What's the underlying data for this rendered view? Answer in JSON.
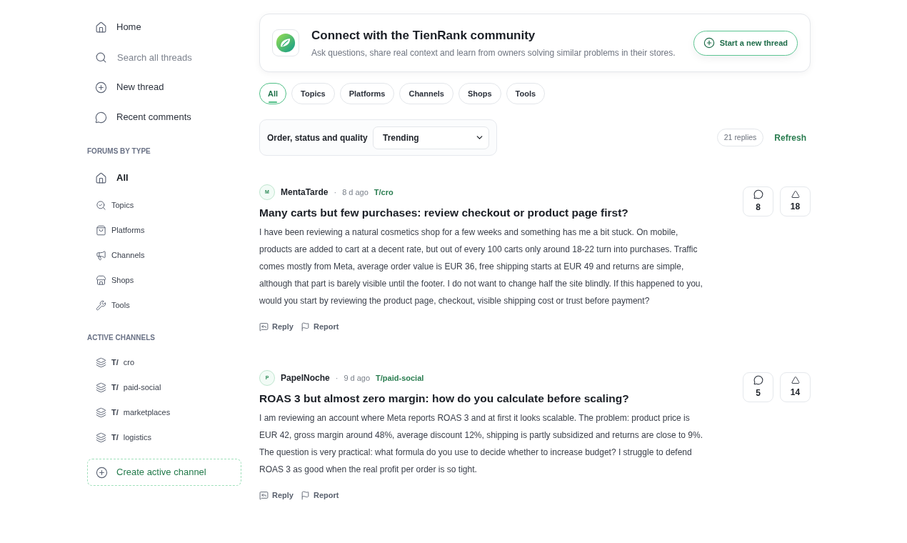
{
  "sidebar": {
    "nav": [
      {
        "kind": "link",
        "label": "Home"
      },
      {
        "kind": "search",
        "placeholder": "Search all threads"
      },
      {
        "kind": "link",
        "label": "New thread"
      },
      {
        "kind": "link",
        "label": "Recent comments"
      }
    ],
    "forums": {
      "heading": "FORUMS BY TYPE",
      "items": [
        {
          "label": "All",
          "selected": true
        },
        {
          "label": "Topics",
          "selected": false
        },
        {
          "label": "Platforms",
          "selected": false
        },
        {
          "label": "Channels",
          "selected": false
        },
        {
          "label": "Shops",
          "selected": false
        },
        {
          "label": "Tools",
          "selected": false
        }
      ]
    },
    "active_channels": {
      "heading": "ACTIVE CHANNELS",
      "items": [
        {
          "prefix": "T/",
          "name": "cro"
        },
        {
          "prefix": "T/",
          "name": "paid-social"
        },
        {
          "prefix": "T/",
          "name": "marketplaces"
        },
        {
          "prefix": "T/",
          "name": "logistics"
        }
      ],
      "create_button": "Create active channel"
    }
  },
  "header": {
    "title": "Connect with the TienRank community",
    "subtitle": "Ask questions, share real context and learn from owners solving similar problems in their stores.",
    "button": "Start a new thread"
  },
  "tabs": [
    {
      "label": "All",
      "selected": true
    },
    {
      "label": "Topics",
      "selected": false
    },
    {
      "label": "Platforms",
      "selected": false
    },
    {
      "label": "Channels",
      "selected": false
    },
    {
      "label": "Shops",
      "selected": false
    },
    {
      "label": "Tools",
      "selected": false
    }
  ],
  "filter": {
    "label": "Order, status and quality",
    "select": {
      "value": "Trending"
    },
    "replies": "21 replies",
    "refresh": "Refresh"
  },
  "posts": [
    {
      "initial": "M",
      "author": "MentaTarde",
      "separator": "·",
      "time": "8 d ago",
      "channel": "T/cro",
      "title": "Many carts but few purchases: review checkout or product page first?",
      "body": "I have been reviewing a natural cosmetics shop for a few weeks and something has me a bit stuck. On mobile, products are added to cart at a decent rate, but out of every 100 carts only around 18-22 turn into purchases. Traffic comes mostly from Meta, average order value is EUR 36, free shipping starts at EUR 49 and returns are simple, although that part is barely visible until the footer. I do not want to change half the site blindly. If this happened to you, would you start by reviewing the product page, checkout, visible shipping cost or trust before payment?",
      "comments": "8",
      "votes": "18",
      "actions": [
        "Reply",
        "Report"
      ]
    },
    {
      "initial": "P",
      "author": "PapelNoche",
      "separator": "·",
      "time": "9 d ago",
      "channel": "T/paid-social",
      "title": "ROAS 3 but almost zero margin: how do you calculate before scaling?",
      "body": "I am reviewing an account where Meta reports ROAS 3 and at first it looks scalable. The problem: product price is EUR 42, gross margin around 48%, average discount 12%, shipping is partly subsidized and returns are close to 9%. The question is very practical: what formula do you use to decide whether to increase budget? I struggle to defend ROAS 3 as good when the real profit per order is so tight.",
      "comments": "5",
      "votes": "14",
      "actions": [
        "Reply",
        "Report"
      ]
    }
  ]
}
